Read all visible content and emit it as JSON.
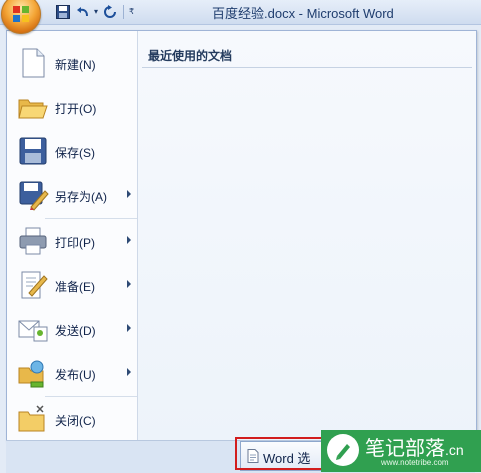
{
  "window": {
    "title": "百度经验.docx - Microsoft Word"
  },
  "quick_access": {
    "dropdown_glyph": "▾",
    "customize_glyph": "₹"
  },
  "menu": {
    "items": [
      {
        "label": "新建(N)",
        "icon": "new-document-icon",
        "submenu": false
      },
      {
        "label": "打开(O)",
        "icon": "open-folder-icon",
        "submenu": false
      },
      {
        "label": "保存(S)",
        "icon": "save-icon",
        "submenu": false
      },
      {
        "label": "另存为(A)",
        "icon": "save-as-icon",
        "submenu": true
      },
      {
        "label": "打印(P)",
        "icon": "print-icon",
        "submenu": true
      },
      {
        "label": "准备(E)",
        "icon": "prepare-icon",
        "submenu": true
      },
      {
        "label": "发送(D)",
        "icon": "send-icon",
        "submenu": true
      },
      {
        "label": "发布(U)",
        "icon": "publish-icon",
        "submenu": true
      },
      {
        "label": "关闭(C)",
        "icon": "close-folder-icon",
        "submenu": false
      }
    ],
    "recent_header": "最近使用的文档",
    "word_options_label": "Word 选"
  },
  "watermark": {
    "name": "笔记部落",
    "suffix": ".cn",
    "url": "www.notetribe.com"
  },
  "colors": {
    "accent": "#2b579a",
    "highlight_border": "#d21d1d",
    "watermark_bg": "#30a050"
  }
}
